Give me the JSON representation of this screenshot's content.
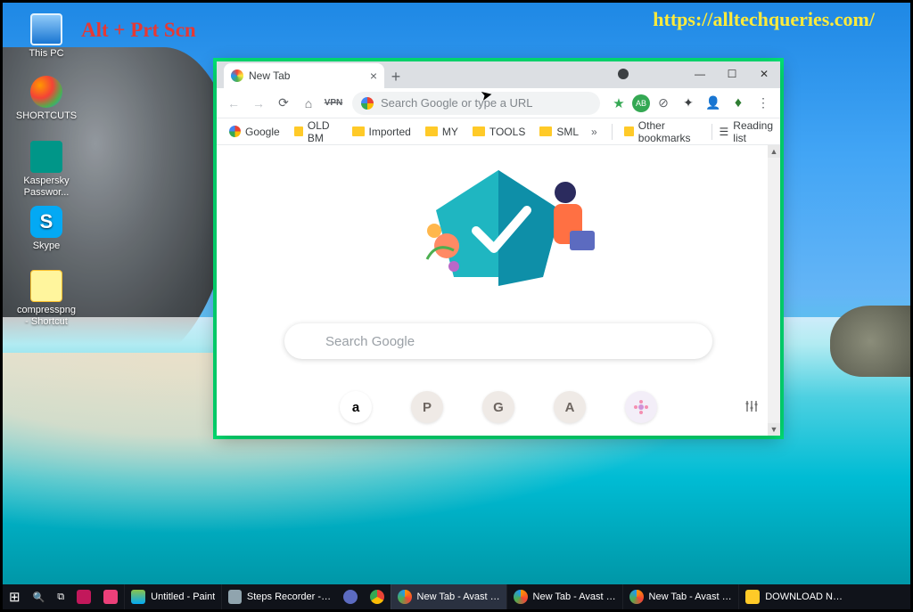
{
  "overlay": {
    "shortcut_text": "Alt + Prt Scn",
    "watermark_url": "https://alltechqueries.com/"
  },
  "desktop_icons": {
    "this_pc": "This PC",
    "shortcuts": "SHORTCUTS",
    "kaspersky": "Kaspersky Passwor...",
    "skype": "Skype",
    "compresspng": "compresspng - Shortcut"
  },
  "chrome": {
    "tab_title": "New Tab",
    "omnibox_placeholder": "Search Google or type a URL",
    "vpn_label": "VPN",
    "profile_badge": "AB",
    "bookmarks": {
      "google": "Google",
      "oldbm": "OLD BM",
      "imported": "Imported",
      "my": "MY",
      "tools": "TOOLS",
      "sml": "SML",
      "other": "Other bookmarks",
      "reading": "Reading list"
    },
    "search_placeholder": "Search Google",
    "shortcuts": {
      "a": "a",
      "p": "P",
      "g": "G",
      "av": "A"
    }
  },
  "taskbar": {
    "paint": "Untitled - Paint",
    "steps": "Steps Recorder - R...",
    "chrome1": "New Tab - Avast S...",
    "chrome2": "New Tab - Avast S...",
    "chrome3": "New Tab - Avast S...",
    "download": "DOWNLOAD NEW"
  }
}
